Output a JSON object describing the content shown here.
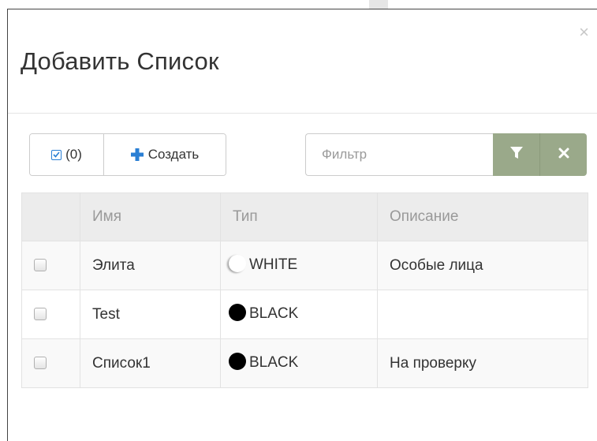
{
  "modal": {
    "title": "Добавить Список",
    "close_label": "×"
  },
  "toolbar": {
    "selected_count": "(0)",
    "create_label": "Создать",
    "filter_placeholder": "Фильтр"
  },
  "table": {
    "headers": [
      "",
      "Имя",
      "Тип",
      "Описание"
    ],
    "rows": [
      {
        "name": "Элита",
        "type": "WHITE",
        "type_color": "#ffffff",
        "description": "Особые лица",
        "checked": false
      },
      {
        "name": "Test",
        "type": "BLACK",
        "type_color": "#000000",
        "description": "",
        "checked": false
      },
      {
        "name": "Список1",
        "type": "BLACK",
        "type_color": "#000000",
        "description": "На проверку",
        "checked": false
      }
    ]
  },
  "colors": {
    "accent_blue": "#2a7fd4",
    "filter_button": "#9aa98a"
  }
}
